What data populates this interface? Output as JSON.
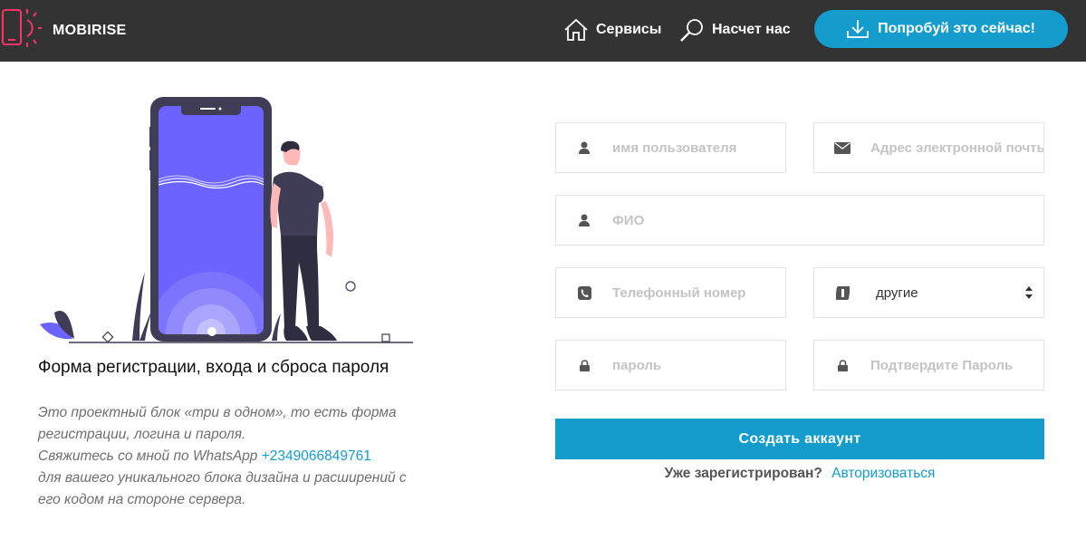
{
  "brand": {
    "name": "MOBIRISE"
  },
  "nav": {
    "services": {
      "label": "Сервисы",
      "icon": "home-icon"
    },
    "about": {
      "label": "Насчет нас",
      "icon": "search-icon"
    },
    "cta": {
      "label": "Попробуй это сейчас!",
      "icon": "download-icon"
    }
  },
  "intro": {
    "title": "Форма регистрации, входа и сброса пароля",
    "text1": "Это проектный блок «три в одном», то есть форма регистрации, логина и пароля.",
    "text2": "Свяжитесь со мной по WhatsApp",
    "phone_link": "+2349066849761",
    "text3": "для вашего уникального блока дизайна и расширений с его кодом на стороне сервера."
  },
  "form": {
    "username": {
      "placeholder": "имя пользователя",
      "icon": "user-icon"
    },
    "email": {
      "placeholder": "Адрес электронной почты",
      "icon": "envelope-icon"
    },
    "fullname": {
      "placeholder": "ФИО",
      "icon": "user-icon"
    },
    "phone": {
      "placeholder": "Телефонный номер",
      "icon": "phone-icon"
    },
    "gender": {
      "selected": "другие",
      "icon": "id-card-icon"
    },
    "password": {
      "placeholder": "пароль",
      "icon": "lock-icon"
    },
    "password_confirm": {
      "placeholder": "Подтвердите Пароль",
      "icon": "lock-icon"
    },
    "submit_label": "Создать аккаунт",
    "already_registered": "Уже зарегистрирован?",
    "login_link": "Авторизоваться"
  },
  "colors": {
    "navbar": "#333333",
    "accent": "#149dcc",
    "phone_screen": "#6c63ff",
    "logo": "#ff3366"
  }
}
